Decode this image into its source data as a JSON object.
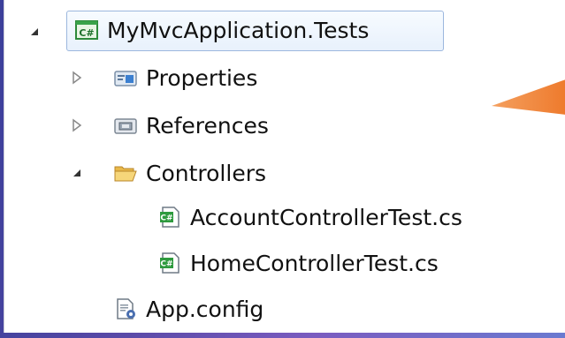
{
  "tree": {
    "root": {
      "label": "MyMvcApplication.Tests",
      "icon": "csharp-project-icon",
      "expanded": true
    },
    "items": [
      {
        "label": "Properties",
        "icon": "properties-folder-icon",
        "expanded": false
      },
      {
        "label": "References",
        "icon": "references-folder-icon",
        "expanded": false
      },
      {
        "label": "Controllers",
        "icon": "open-folder-icon",
        "expanded": true
      },
      {
        "label": "AccountControllerTest.cs",
        "icon": "csharp-file-icon"
      },
      {
        "label": "HomeControllerTest.cs",
        "icon": "csharp-file-icon"
      },
      {
        "label": "App.config",
        "icon": "config-file-icon"
      }
    ]
  },
  "colors": {
    "selection_border": "#9cb7de",
    "arrow": "#f08a3c",
    "background": "#5a4aa8"
  }
}
